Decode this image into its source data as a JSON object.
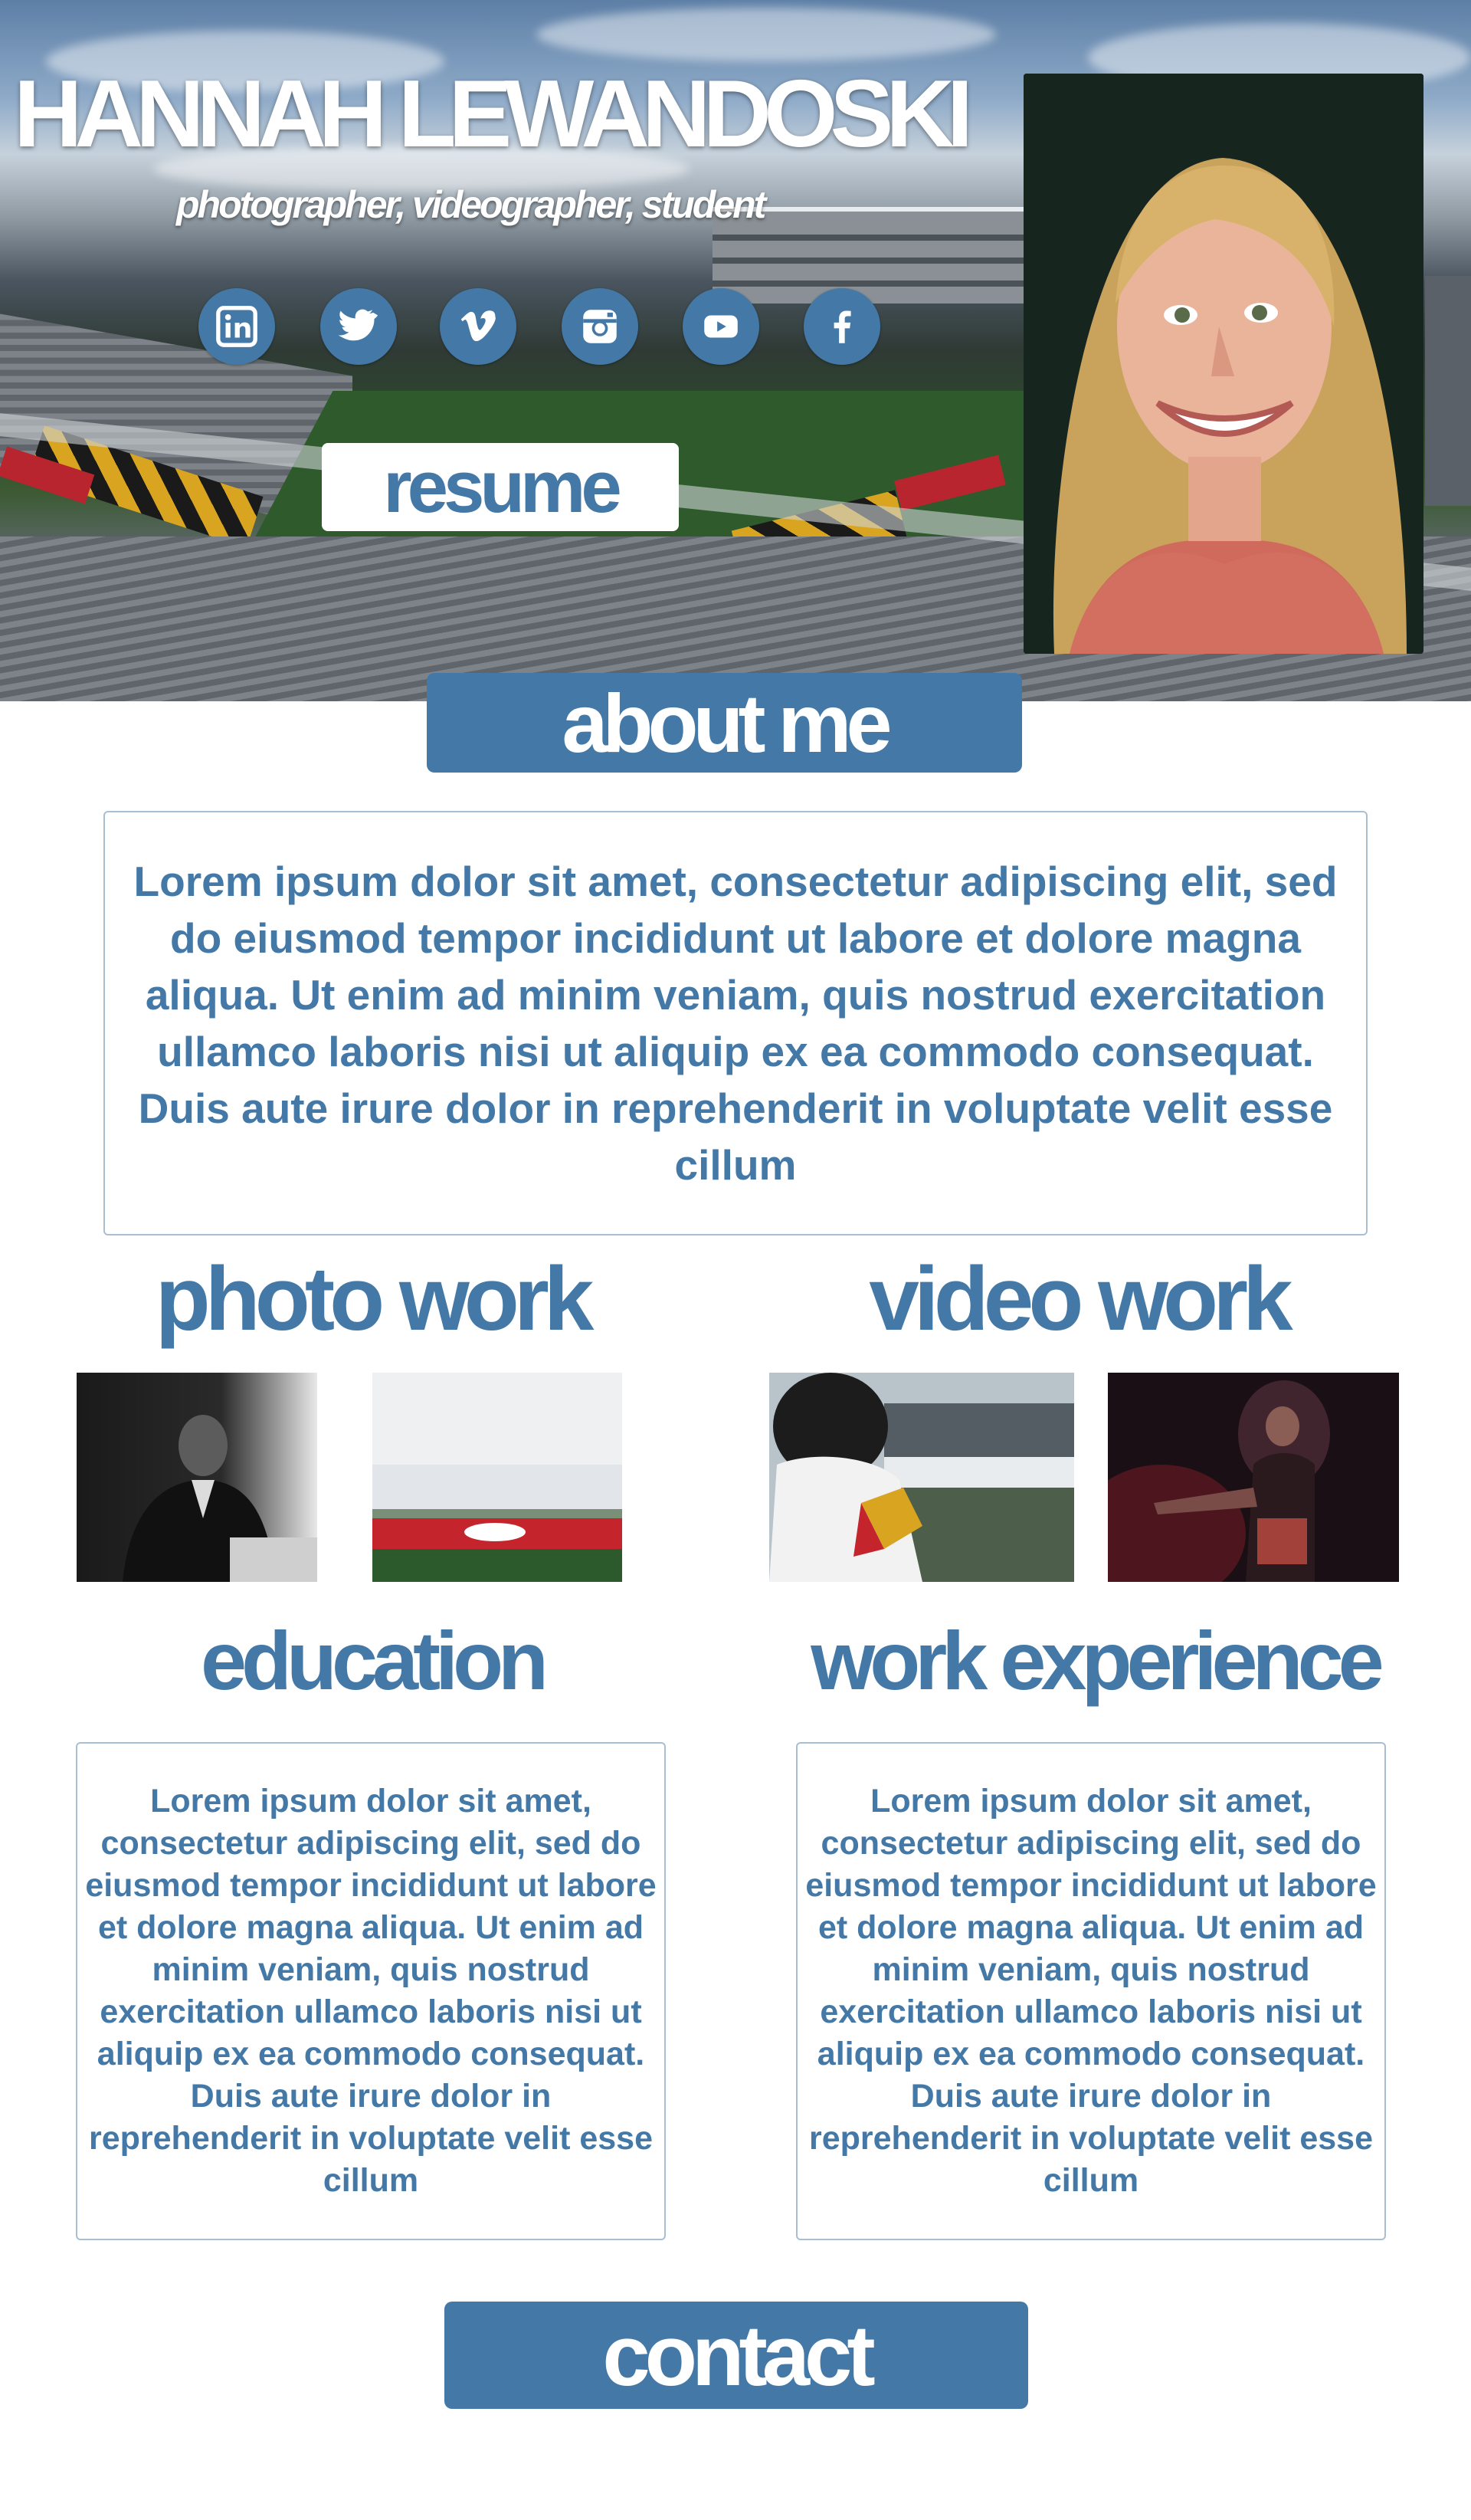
{
  "hero": {
    "name": "HANNAH LEWANDOSKI",
    "subtitle": "photographer, videographer, student",
    "resume_label": "resume",
    "social": [
      {
        "icon": "linkedin-icon"
      },
      {
        "icon": "twitter-icon"
      },
      {
        "icon": "vimeo-icon"
      },
      {
        "icon": "instagram-icon"
      },
      {
        "icon": "youtube-icon"
      },
      {
        "icon": "facebook-icon"
      }
    ]
  },
  "about": {
    "heading": "about me",
    "text": "Lorem ipsum dolor sit amet, consectetur adipiscing elit, sed do eiusmod tempor incididunt ut labore et dolore magna aliqua. Ut enim ad minim veniam, quis nostrud exercitation ullamco laboris nisi ut aliquip ex ea commodo consequat. Duis aute irure dolor in reprehenderit in voluptate velit esse cillum"
  },
  "photo_work": {
    "heading": "photo work"
  },
  "video_work": {
    "heading": "video work"
  },
  "education": {
    "heading": "education",
    "text": "Lorem ipsum dolor sit amet, consectetur adipiscing elit, sed do eiusmod tempor incididunt ut labore et dolore magna aliqua. Ut enim ad minim veniam, quis nostrud exercitation ullamco laboris nisi ut aliquip ex ea commodo consequat. Duis aute irure dolor in reprehenderit in voluptate velit esse cillum"
  },
  "work_experience": {
    "heading": "work experience",
    "text": "Lorem ipsum dolor sit amet, consectetur adipiscing elit, sed do eiusmod tempor incididunt ut labore et dolore magna aliqua. Ut enim ad minim veniam, quis nostrud exercitation ullamco laboris nisi ut aliquip ex ea commodo consequat. Duis aute irure dolor in reprehenderit in voluptate velit esse cillum"
  },
  "contact": {
    "label": "contact"
  },
  "colors": {
    "accent": "#4479a7",
    "border": "#a8bfd3",
    "background": "#ffffff"
  }
}
